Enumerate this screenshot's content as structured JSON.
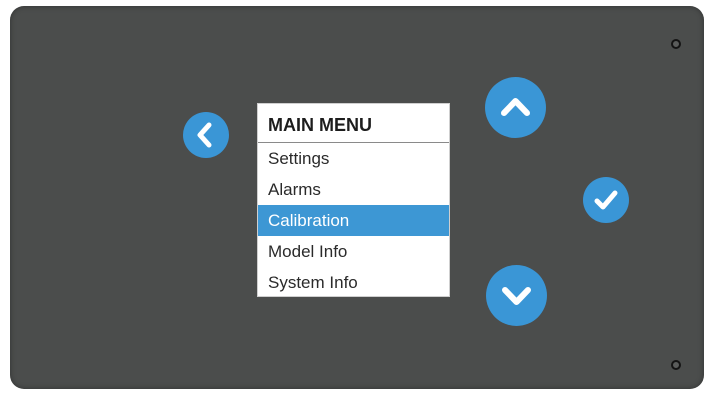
{
  "menu": {
    "title": "MAIN MENU",
    "items": [
      {
        "label": "Settings",
        "selected": false
      },
      {
        "label": "Alarms",
        "selected": false
      },
      {
        "label": "Calibration",
        "selected": true
      },
      {
        "label": "Model Info",
        "selected": false
      },
      {
        "label": "System Info",
        "selected": false
      }
    ]
  },
  "buttons": {
    "back": {
      "icon": "chevron-left-icon"
    },
    "up": {
      "icon": "chevron-up-icon"
    },
    "down": {
      "icon": "chevron-down-icon"
    },
    "ok": {
      "icon": "checkmark-icon"
    }
  },
  "colors": {
    "panel": "#4b4d4c",
    "accent": "#3a96d6",
    "selected_row": "#3d97d4",
    "menu_background": "#ffffff"
  }
}
